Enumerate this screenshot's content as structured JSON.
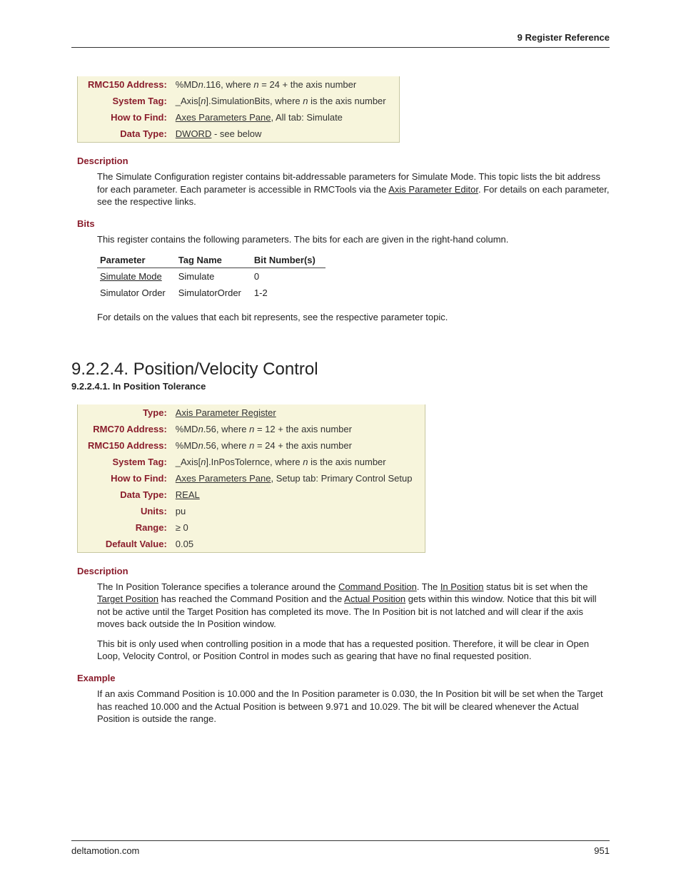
{
  "header": "9  Register Reference",
  "table1": {
    "rmc150_addr_label": "RMC150 Address:",
    "rmc150_addr_prefix": "%MD",
    "rmc150_addr_n": "n",
    "rmc150_addr_mid": ".116, where ",
    "rmc150_addr_n2": "n",
    "rmc150_addr_suffix": " = 24 + the axis number",
    "systag_label": "System Tag:",
    "systag_prefix": "_Axis[",
    "systag_n": "n",
    "systag_mid": "].SimulationBits, where ",
    "systag_n2": "n",
    "systag_suffix": " is the axis number",
    "howto_label": "How to Find:",
    "howto_link": "Axes Parameters Pane",
    "howto_rest": ", All tab: Simulate",
    "datatype_label": "Data Type:",
    "datatype_link": "DWORD",
    "datatype_rest": " - see below"
  },
  "desc1": {
    "head": "Description",
    "p1a": "The Simulate Configuration register contains bit-addressable parameters for Simulate Mode. This topic lists the bit address for each parameter. Each parameter is accessible in RMCTools via the ",
    "p1link": "Axis Parameter Editor",
    "p1b": ". For details on each parameter, see the respective links."
  },
  "bits": {
    "head": "Bits",
    "intro": "This register contains the following parameters. The bits for each are given in the right-hand column.",
    "col1": "Parameter",
    "col2": "Tag Name",
    "col3": "Bit Number(s)",
    "r1c1": "Simulate Mode",
    "r1c2": "Simulate",
    "r1c3": "0",
    "r2c1": "Simulator Order",
    "r2c2": "SimulatorOrder",
    "r2c3": "1-2",
    "outro": "For details on the values that each bit represents, see the respective parameter topic."
  },
  "section": "9.2.2.4. Position/Velocity Control",
  "subsection": "9.2.2.4.1. In Position Tolerance",
  "table2": {
    "type_label": "Type:",
    "type_link": "Axis Parameter Register",
    "rmc70_label": "RMC70 Address:",
    "rmc70_prefix": "%MD",
    "rmc70_n": "n",
    "rmc70_mid": ".56, where ",
    "rmc70_n2": "n",
    "rmc70_suffix": " = 12 + the axis number",
    "rmc150_label": "RMC150 Address:",
    "rmc150_prefix": "%MD",
    "rmc150_n": "n",
    "rmc150_mid": ".56, where ",
    "rmc150_n2": "n",
    "rmc150_suffix": " = 24 + the axis number",
    "systag_label": "System Tag:",
    "systag_prefix": "_Axis[",
    "systag_n": "n",
    "systag_mid": "].InPosTolernce, where ",
    "systag_n2": "n",
    "systag_suffix": " is the axis number",
    "howto_label": "How to Find:",
    "howto_link": "Axes Parameters Pane",
    "howto_rest": ", Setup tab: Primary Control Setup",
    "datatype_label": "Data Type:",
    "datatype_link": "REAL",
    "units_label": "Units:",
    "units_val": "pu",
    "range_label": "Range:",
    "range_val": "≥ 0",
    "default_label": "Default Value:",
    "default_val": "0.05"
  },
  "desc2": {
    "head": "Description",
    "p1a": "The In Position Tolerance specifies a tolerance around the ",
    "p1l1": "Command Position",
    "p1b": ". The ",
    "p1l2": "In Position",
    "p1c": " status bit is set when the ",
    "p1l3": "Target Position",
    "p1d": " has reached the Command Position and the ",
    "p1l4": "Actual Position",
    "p1e": " gets within this window. Notice that this bit will not be active until the Target Position has completed its move. The In Position bit is not latched and will clear if the axis moves back outside the In Position window.",
    "p2": "This bit is only used when controlling position in a mode that has a requested position. Therefore, it will be clear in Open Loop, Velocity Control, or Position Control in modes such as gearing that have no final requested position."
  },
  "example": {
    "head": "Example",
    "p": "If an axis Command Position is 10.000 and the In Position parameter is 0.030, the In Position bit will be set when the Target has reached 10.000 and the Actual Position is between 9.971 and 10.029.  The bit will be cleared whenever the Actual Position is outside the range."
  },
  "footer": {
    "left": "deltamotion.com",
    "right": "951"
  }
}
